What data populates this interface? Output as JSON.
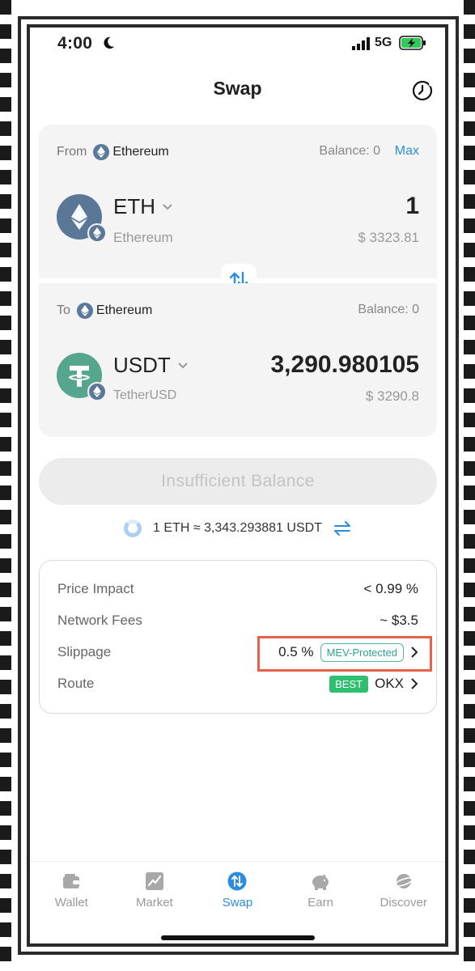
{
  "status": {
    "time": "4:00",
    "network": "5G"
  },
  "header": {
    "title": "Swap"
  },
  "from": {
    "label": "From",
    "chain": "Ethereum",
    "balance": "Balance: 0",
    "max": "Max",
    "token_symbol": "ETH",
    "token_name": "Ethereum",
    "amount": "1",
    "fiat": "$ 3323.81"
  },
  "to": {
    "label": "To",
    "chain": "Ethereum",
    "balance": "Balance: 0",
    "token_symbol": "USDT",
    "token_name": "TetherUSD",
    "amount": "3,290.980105",
    "fiat": "$ 3290.8"
  },
  "action": {
    "label": "Insufficient Balance"
  },
  "rate": {
    "text": "1 ETH ≈ 3,343.293881 USDT"
  },
  "details": {
    "price_impact": {
      "label": "Price Impact",
      "value": "< 0.99 %"
    },
    "network_fees": {
      "label": "Network Fees",
      "value": "~ $3.5"
    },
    "slippage": {
      "label": "Slippage",
      "value": "0.5 %",
      "tag": "MEV-Protected"
    },
    "route": {
      "label": "Route",
      "badge": "BEST",
      "value": "OKX"
    }
  },
  "tabs": [
    {
      "label": "Wallet",
      "icon": "wallet-icon",
      "active": false
    },
    {
      "label": "Market",
      "icon": "market-chart-icon",
      "active": false
    },
    {
      "label": "Swap",
      "icon": "swap-icon",
      "active": true
    },
    {
      "label": "Earn",
      "icon": "piggy-bank-icon",
      "active": false
    },
    {
      "label": "Discover",
      "icon": "planet-icon",
      "active": false
    }
  ],
  "colors": {
    "accent": "#2a8de0",
    "eth": "#5b7797",
    "usdt": "#56a58e",
    "mev": "#2fa38e",
    "best": "#2fbf71",
    "highlight": "#e8604a"
  }
}
